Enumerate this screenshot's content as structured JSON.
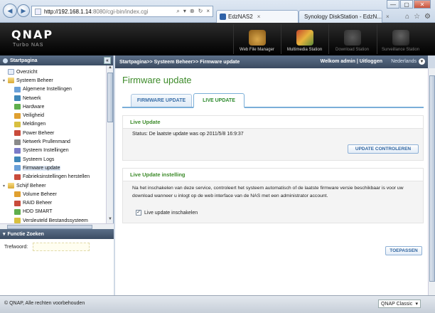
{
  "browser": {
    "url_host": "http://192.168.1.14",
    "url_rest": ":8080/cgi-bin/index.cgi",
    "tabs": [
      {
        "label": "EdzNAS2",
        "close": "×"
      },
      {
        "label": "Synology DiskStation - EdzN...",
        "close": "×"
      }
    ],
    "addr_icons": [
      "⌕",
      "▾",
      "⊗",
      "↻",
      "×"
    ],
    "win_controls": [
      "—",
      "▢",
      "✕"
    ],
    "tools": [
      "⌂",
      "☆",
      "⚙"
    ]
  },
  "header": {
    "logo": "QNAP",
    "logo_sub": "Turbo NAS",
    "apps": [
      {
        "label": "Web File Manager",
        "enabled": true
      },
      {
        "label": "Multimedia Station",
        "enabled": true
      },
      {
        "label": "Download Station",
        "enabled": false
      },
      {
        "label": "Surveillance Station",
        "enabled": false
      }
    ]
  },
  "left_panel": {
    "title": "Startpagina",
    "collapse": "«",
    "tree": [
      {
        "label": "Overzicht",
        "level": 0,
        "icon": "page",
        "twisty": ""
      },
      {
        "label": "Systeem Beheer",
        "level": 0,
        "icon": "folder",
        "twisty": "▾"
      },
      {
        "label": "Algemene Instellingen",
        "level": 1,
        "icon": "a"
      },
      {
        "label": "Netwerk",
        "level": 1,
        "icon": "f"
      },
      {
        "label": "Hardware",
        "level": 1,
        "icon": "b"
      },
      {
        "label": "Veiligheid",
        "level": 1,
        "icon": "d"
      },
      {
        "label": "Meldingen",
        "level": 1,
        "icon": "h"
      },
      {
        "label": "Power Beheer",
        "level": 1,
        "icon": "c"
      },
      {
        "label": "Netwerk Prullenmand",
        "level": 1,
        "icon": "g"
      },
      {
        "label": "Systeem Instellingen",
        "level": 1,
        "icon": "e"
      },
      {
        "label": "Systeem Logs",
        "level": 1,
        "icon": "f"
      },
      {
        "label": "Firmware update",
        "level": 1,
        "icon": "a",
        "selected": true
      },
      {
        "label": "Fabrieksinstellingen herstellen",
        "level": 1,
        "icon": "c"
      },
      {
        "label": "Schijf Beheer",
        "level": 0,
        "icon": "folder",
        "twisty": "▾"
      },
      {
        "label": "Volume Beheer",
        "level": 1,
        "icon": "d"
      },
      {
        "label": "RAID Beheer",
        "level": 1,
        "icon": "c"
      },
      {
        "label": "HDD SMART",
        "level": 1,
        "icon": "b"
      },
      {
        "label": "Versleuteld Bestandssysteem",
        "level": 1,
        "icon": "h"
      }
    ],
    "search_title": "Functie Zoeken",
    "search_label": "Trefwoord:",
    "search_value": ""
  },
  "main": {
    "breadcrumb": "Startpagina>> Systeem Beheer>> Firmware update",
    "welcome": "Welkom admin | Uitloggen",
    "language": "Nederlands",
    "title": "Firmware update",
    "tabs": [
      {
        "label": "FIRMWARE UPDATE",
        "active": false
      },
      {
        "label": "LIVE UPDATE",
        "active": true
      }
    ],
    "live_update": {
      "title": "Live Update",
      "status": "Status: De laatste update was op 2011/5/8 16:9:37",
      "check_button": "UPDATE CONTROLEREN"
    },
    "live_update_setting": {
      "title": "Live Update instelling",
      "description": "Na het inschakelen van deze service, controleert het systeem automatisch of de laatste firmware versie beschikbaar is voor uw download wanneer u inlogt op de web interface van de NAS met een administrator account.",
      "checkbox_label": "Live update inschakelen",
      "checked": true
    },
    "apply_button": "TOEPASSEN"
  },
  "footer": {
    "copyright": "© QNAP, Alle rechten voorbehouden",
    "theme": "QNAP Classic"
  }
}
